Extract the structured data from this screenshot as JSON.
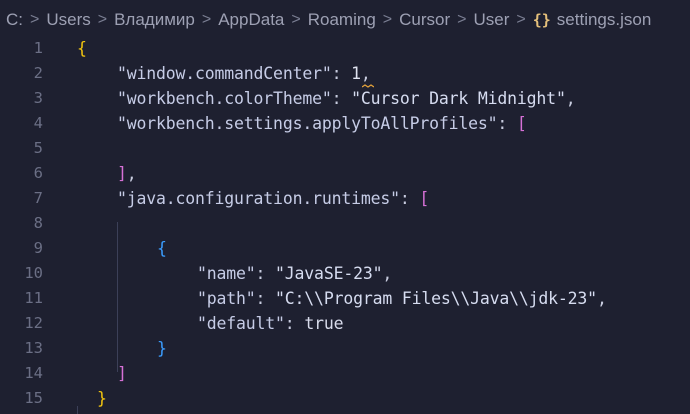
{
  "breadcrumb": {
    "items": [
      "C:",
      "Users",
      "Владимир",
      "AppData",
      "Roaming",
      "Cursor",
      "User"
    ],
    "file_icon": "{}",
    "file_name": "settings.json"
  },
  "line_numbers": [
    "1",
    "2",
    "3",
    "4",
    "5",
    "6",
    "7",
    "8",
    "9",
    "10",
    "11",
    "12",
    "13",
    "14",
    "15"
  ],
  "code": {
    "l1_open": "{",
    "l2_key": "\"window.commandCenter\"",
    "l2_colon": ": ",
    "l2_val": "1",
    "l2_comma": ",",
    "l3_key": "\"workbench.colorTheme\"",
    "l3_colon": ": ",
    "l3_val": "\"Cursor Dark Midnight\"",
    "l3_comma": ",",
    "l4_key": "\"workbench.settings.applyToAllProfiles\"",
    "l4_colon": ": ",
    "l4_open": "[",
    "l6_close": "]",
    "l6_comma": ",",
    "l7_key": "\"java.configuration.runtimes\"",
    "l7_colon": ": ",
    "l7_open": "[",
    "l9_open": "{",
    "l10_key": "\"name\"",
    "l10_colon": ": ",
    "l10_val": "\"JavaSE-23\"",
    "l10_comma": ",",
    "l11_key": "\"path\"",
    "l11_colon": ": ",
    "l11_val": "\"C:\\\\Program Files\\\\Java\\\\jdk-23\"",
    "l11_comma": ",",
    "l12_key": "\"default\"",
    "l12_colon": ": ",
    "l12_val": "true",
    "l13_close": "}",
    "l14_close": "]",
    "l15_close": "}"
  },
  "colors": {
    "background": "#1e2030",
    "bracket_level1": "#f1c40f",
    "bracket_level2": "#d670d6",
    "bracket_level3": "#3b9dff",
    "warning_squiggle": "#e5a33b"
  }
}
